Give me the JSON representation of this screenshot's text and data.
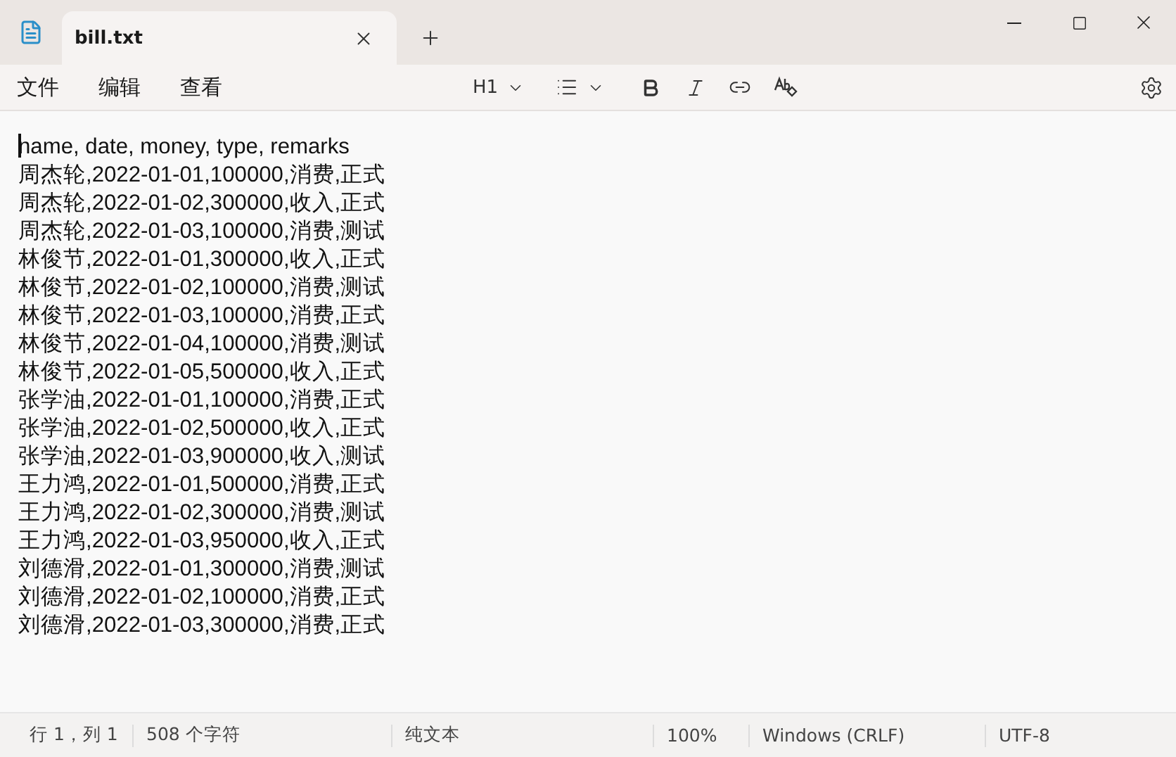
{
  "tab": {
    "title": "bill.txt",
    "selected": true
  },
  "menu": [
    "文件",
    "编辑",
    "查看"
  ],
  "heading_menu": "H1",
  "lines": [
    "name, date, money, type, remarks",
    "周杰轮,2022-01-01,100000,消费,正式",
    "周杰轮,2022-01-02,300000,收入,正式",
    "周杰轮,2022-01-03,100000,消费,测试",
    "林俊节,2022-01-01,300000,收入,正式",
    "林俊节,2022-01-02,100000,消费,测试",
    "林俊节,2022-01-03,100000,消费,正式",
    "林俊节,2022-01-04,100000,消费,测试",
    "林俊节,2022-01-05,500000,收入,正式",
    "张学油,2022-01-01,100000,消费,正式",
    "张学油,2022-01-02,500000,收入,正式",
    "张学油,2022-01-03,900000,收入,测试",
    "王力鸿,2022-01-01,500000,消费,正式",
    "王力鸿,2022-01-02,300000,消费,测试",
    "王力鸿,2022-01-03,950000,收入,正式",
    "刘德滑,2022-01-01,300000,消费,测试",
    "刘德滑,2022-01-02,100000,消费,正式",
    "刘德滑,2022-01-03,300000,消费,正式"
  ],
  "status_bar": [
    "行 1，列 1",
    "508 个字符",
    "纯文本",
    "100%",
    "Windows (CRLF)",
    "UTF-8"
  ]
}
